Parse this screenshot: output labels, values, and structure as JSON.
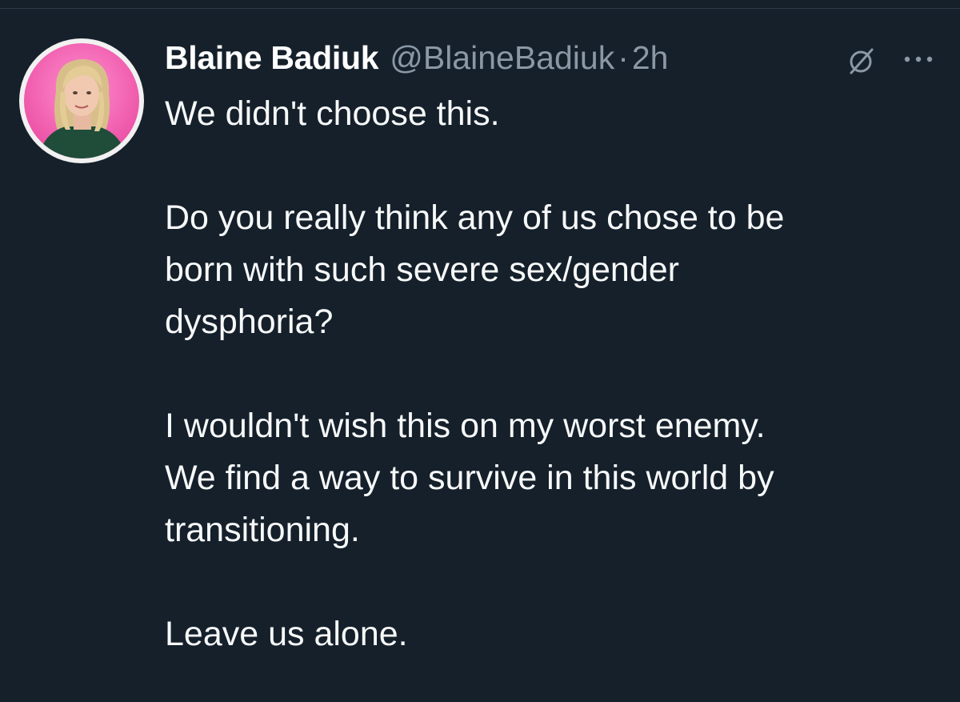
{
  "tweet": {
    "author": {
      "display_name": "Blaine Badiuk",
      "handle": "@BlaineBadiuk",
      "avatar_icon": "profile-photo"
    },
    "separator": "·",
    "timestamp": "2h",
    "icons": {
      "grok": "grok-icon",
      "more": "more-options-icon"
    },
    "paragraphs": [
      [
        "We didn't choose this."
      ],
      [
        "Do you really think any of us chose to be",
        "born with such severe sex/gender",
        "dysphoria?"
      ],
      [
        "I wouldn't wish this on my worst enemy.",
        "We find a way to survive in this world by",
        "transitioning."
      ],
      [
        "Leave us alone."
      ]
    ]
  },
  "colors": {
    "background": "#15202b",
    "primary_text": "#f7f9f9",
    "secondary_text": "#8b98a5",
    "avatar_background": "#f25fb0"
  }
}
